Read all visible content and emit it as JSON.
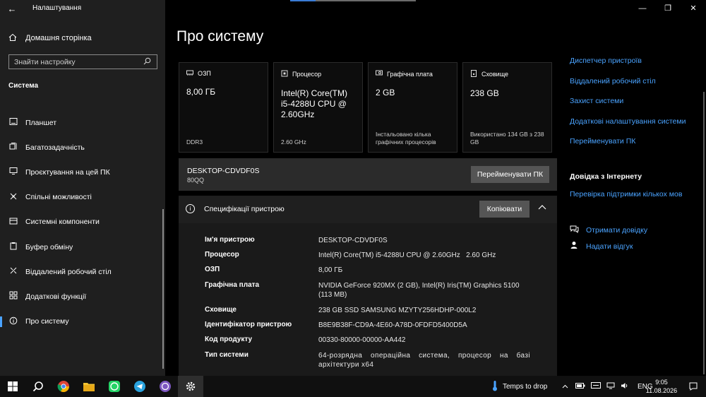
{
  "window": {
    "title": "Налаштування",
    "back_glyph": "←",
    "minimize_glyph": "—",
    "maximize_glyph": "❐",
    "close_glyph": "✕"
  },
  "sidebar": {
    "home_label": "Домашня сторінка",
    "search_placeholder": "Знайти настройку",
    "section_label": "Система",
    "items": [
      {
        "label": "Планшет",
        "icon": "tablet-icon"
      },
      {
        "label": "Багатозадачність",
        "icon": "multitasking-icon"
      },
      {
        "label": "Проєктування на цей ПК",
        "icon": "projecting-icon"
      },
      {
        "label": "Спільні можливості",
        "icon": "shared-experiences-icon"
      },
      {
        "label": "Системні компоненти",
        "icon": "system-components-icon"
      },
      {
        "label": "Буфер обміну",
        "icon": "clipboard-icon"
      },
      {
        "label": "Віддалений робочий стіл",
        "icon": "remote-desktop-icon"
      },
      {
        "label": "Додаткові функції",
        "icon": "optional-features-icon"
      },
      {
        "label": "Про систему",
        "icon": "info-icon",
        "active": true
      }
    ]
  },
  "main": {
    "page_title": "Про систему",
    "cards": [
      {
        "icon": "ram-icon",
        "label": "ОЗП",
        "value": "8,00 ГБ",
        "sub": "DDR3"
      },
      {
        "icon": "cpu-icon",
        "label": "Процесор",
        "value": "Intel(R) Core(TM) i5-4288U CPU @ 2.60GHz",
        "sub": "2.60 GHz"
      },
      {
        "icon": "gpu-icon",
        "label": "Графічна плата",
        "value": "2 GB",
        "sub": "Інстальовано кілька графічних процесорів"
      },
      {
        "icon": "storage-icon",
        "label": "Сховище",
        "value": "238 GB",
        "sub": "Використано 134 GB з 238 GB"
      }
    ],
    "device": {
      "name": "DESKTOP-CDVDF0S",
      "model": "80QQ",
      "rename_button": "Перейменувати ПК"
    },
    "specs": {
      "title": "Специфікації пристрою",
      "copy_button": "Копіювати",
      "rows": [
        {
          "key": "Ім'я пристрою",
          "value": "DESKTOP-CDVDF0S"
        },
        {
          "key": "Процесор",
          "value": "Intel(R) Core(TM) i5-4288U CPU @ 2.60GHz   2.60 GHz"
        },
        {
          "key": "ОЗП",
          "value": "8,00 ГБ"
        },
        {
          "key": "Графічна плата",
          "value": "NVIDIA GeForce 920MX (2 GB), Intel(R) Iris(TM) Graphics 5100 (113 MB)"
        },
        {
          "key": "Сховище",
          "value": "238 GB SSD SAMSUNG MZYTY256HDHP-000L2"
        },
        {
          "key": "Ідентифікатор пристрою",
          "value": "B8E9B38F-CD9A-4E60-A78D-0FDFD5400D5A"
        },
        {
          "key": "Код продукту",
          "value": "00330-80000-00000-AA442"
        },
        {
          "key": "Тип системи",
          "value": "64-розрядна операційна система, процесор на базі архітектури x64"
        }
      ]
    }
  },
  "related": {
    "links": [
      "Диспетчер пристроїв",
      "Віддалений робочий стіл",
      "Захист системи",
      "Додаткові налаштування системи",
      "Перейменувати ПК"
    ],
    "help_heading": "Довідка з Інтернету",
    "help_link": "Перевірка підтримки кількох мов",
    "get_help": "Отримати довідку",
    "feedback": "Надати відгук"
  },
  "taskbar": {
    "apps": [
      "start-icon",
      "search-icon",
      "chrome-icon",
      "file-explorer-icon",
      "whatsapp-icon",
      "telegram-icon",
      "viber-icon",
      "settings-icon"
    ],
    "weather_text": "Temps to drop",
    "language": "ENG",
    "time": "9:05",
    "date": "11.08.2026"
  },
  "colors": {
    "accent": "#4aa3ff",
    "sidebar_bg": "#1f1f1f",
    "button_bg": "#555555"
  }
}
